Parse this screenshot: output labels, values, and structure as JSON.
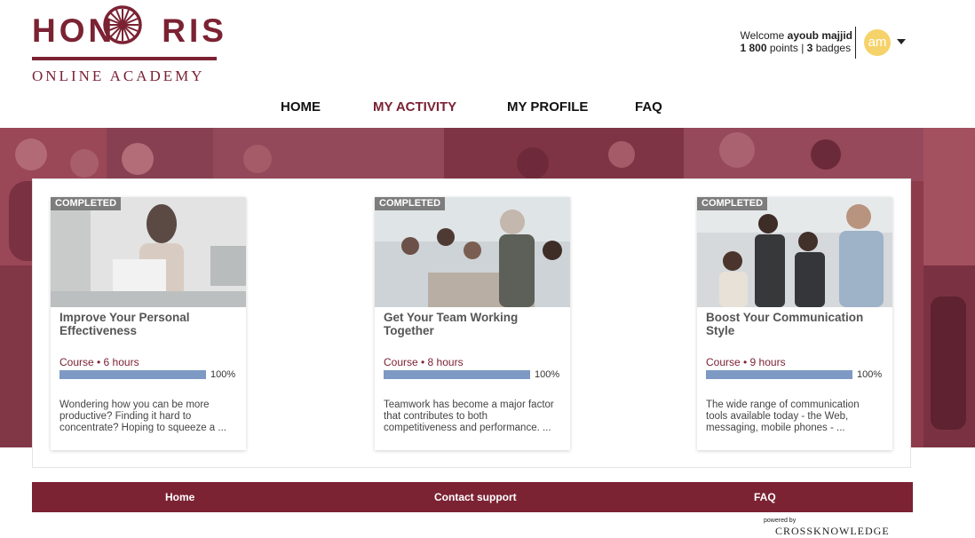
{
  "brand": {
    "logo_text_left": "HON",
    "logo_text_right": "RIS",
    "tagline": "ONLINE ACADEMY",
    "color": "#7b2233"
  },
  "user": {
    "welcome_prefix": "Welcome ",
    "name": "ayoub majjid",
    "points_value": "1 800",
    "points_label": " points | ",
    "badges_value": "3",
    "badges_label": " badges",
    "initials": "am"
  },
  "nav": {
    "items": [
      "HOME",
      "MY ACTIVITY",
      "MY PROFILE",
      "FAQ"
    ],
    "active": "MY ACTIVITY"
  },
  "cards": [
    {
      "status": "COMPLETED",
      "title": "Improve Your Personal Effectiveness",
      "meta": "Course • 6 hours",
      "progress": 100,
      "progress_label": "100%",
      "description": "Wondering how you can be more productive? Finding it hard to concentrate? Hoping to squeeze a ..."
    },
    {
      "status": "COMPLETED",
      "title": "Get Your Team Working Together",
      "meta": "Course • 8 hours",
      "progress": 100,
      "progress_label": "100%",
      "description": "Teamwork has become a major factor that contributes to both competitiveness and performance. ..."
    },
    {
      "status": "COMPLETED",
      "title": "Boost Your Communication Style",
      "meta": "Course • 9 hours",
      "progress": 100,
      "progress_label": "100%",
      "description": "The wide range of communication tools available today - the Web, messaging, mobile phones - ..."
    }
  ],
  "footer": {
    "links": [
      "Home",
      "Contact support",
      "FAQ"
    ],
    "powered_by": "powered by",
    "powered_logo": "CROSSKNOWLEDGE"
  },
  "colors": {
    "accent": "#7b2233",
    "progress": "#7e99c4",
    "avatar": "#f5d36a",
    "badge": "#7d7d7d"
  }
}
